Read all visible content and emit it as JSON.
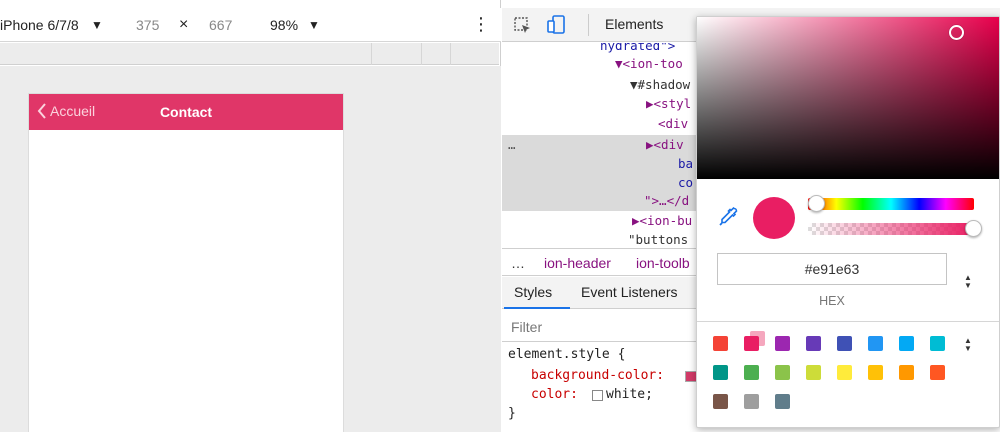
{
  "device_toolbar": {
    "device": "iPhone 6/7/8",
    "dropdown_glyph": "▼",
    "width": "375",
    "times": "×",
    "height": "667",
    "zoom": "98%",
    "more_glyph": "⋮"
  },
  "app": {
    "back_label": "Accueil",
    "title": "Contact",
    "header_color": "#e03668"
  },
  "devtools": {
    "elements_tab": "Elements",
    "dom_lines": [
      {
        "text": "hydrated\">",
        "cls": "txt"
      },
      {
        "text": "▼<ion-too",
        "cls": "tag"
      },
      {
        "text": "▼#shadow",
        "cls": ""
      },
      {
        "text": "▶<styl",
        "cls": "tag"
      },
      {
        "text": "<div",
        "cls": "tag"
      },
      {
        "text": "▶<div",
        "cls": "tag"
      },
      {
        "text": "ba",
        "cls": "txt"
      },
      {
        "text": "co",
        "cls": "txt"
      },
      {
        "text": "\">…</d",
        "cls": "tag"
      },
      {
        "text": "▶<ion-bu",
        "cls": "tag"
      },
      {
        "text": "\"buttons",
        "cls": ""
      }
    ],
    "ellipsis": "…",
    "breadcrumbs": [
      "ion-header",
      "ion-toolb"
    ],
    "styles_tabs": [
      "Styles",
      "Event Listeners"
    ],
    "filter_placeholder": "Filter",
    "rules": {
      "selector": "element.style {",
      "prop1": "background-color:",
      "prop2": "color:",
      "value2": "white;",
      "close": "}"
    }
  },
  "picker": {
    "hex_value": "#e91e63",
    "format_label": "HEX",
    "current_color": "#e91e63",
    "palette": [
      "#f44336",
      "#e91e63",
      "#9c27b0",
      "#673ab7",
      "#3f51b5",
      "#2196f3",
      "#03a9f4",
      "#00bcd4",
      "#009688",
      "#4caf50",
      "#8bc34a",
      "#cddc39",
      "#ffeb3b",
      "#ffc107",
      "#ff9800",
      "#ff5722",
      "#795548",
      "#9e9e9e",
      "#607d8b"
    ]
  }
}
